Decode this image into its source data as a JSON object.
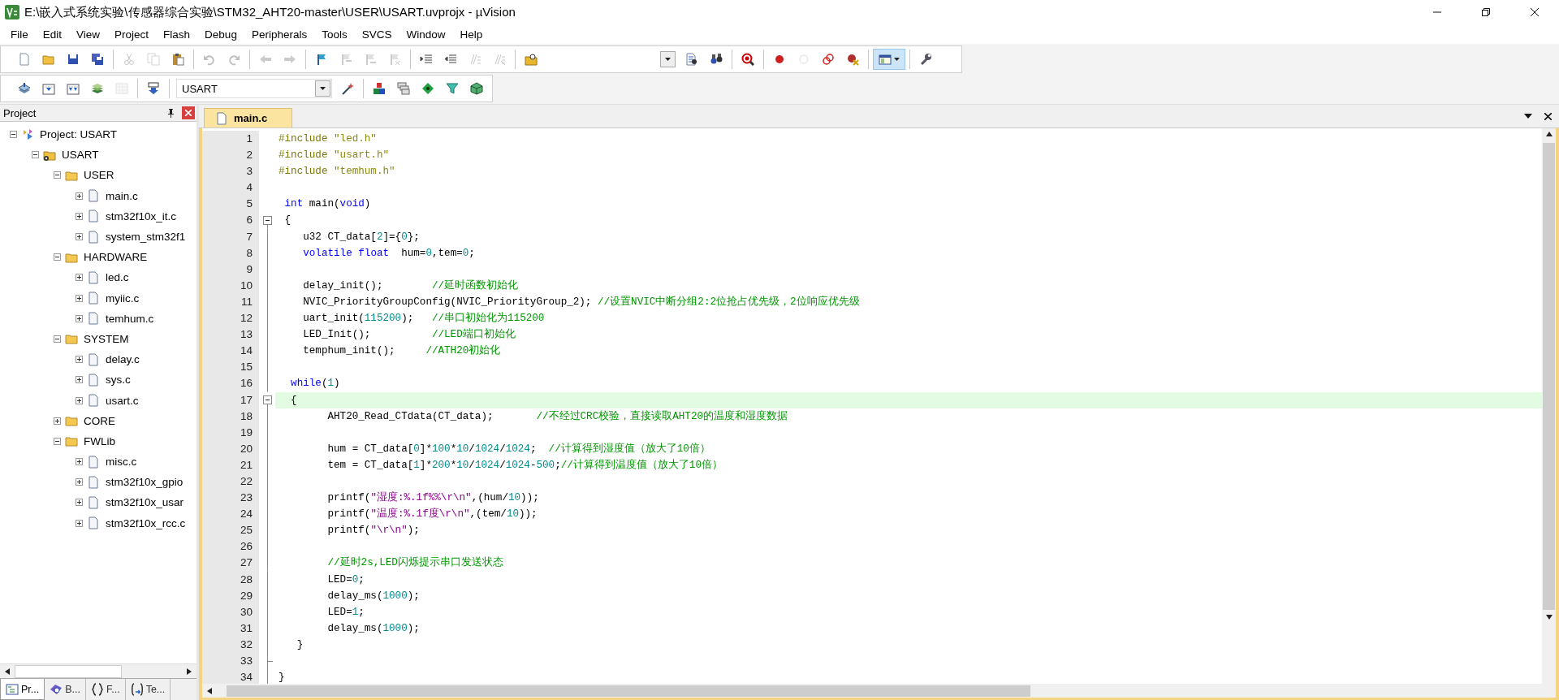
{
  "window": {
    "title": "E:\\嵌入式系统实验\\传感器综合实验\\STM32_AHT20-master\\USER\\USART.uvprojx - µVision"
  },
  "menu": [
    "File",
    "Edit",
    "View",
    "Project",
    "Flash",
    "Debug",
    "Peripherals",
    "Tools",
    "SVCS",
    "Window",
    "Help"
  ],
  "toolbar_1": [
    {
      "kind": "new",
      "disabled": false
    },
    {
      "kind": "open",
      "disabled": false
    },
    {
      "kind": "save",
      "disabled": false
    },
    {
      "kind": "save-all",
      "disabled": false
    },
    {
      "kind": "separator"
    },
    {
      "kind": "cut",
      "disabled": true
    },
    {
      "kind": "copy",
      "disabled": true
    },
    {
      "kind": "paste",
      "disabled": false
    },
    {
      "kind": "separator"
    },
    {
      "kind": "undo",
      "disabled": true
    },
    {
      "kind": "redo",
      "disabled": true
    },
    {
      "kind": "separator"
    },
    {
      "kind": "back",
      "disabled": true
    },
    {
      "kind": "forward",
      "disabled": true
    },
    {
      "kind": "separator"
    },
    {
      "kind": "bookmark",
      "disabled": false
    },
    {
      "kind": "bookmark-prev",
      "disabled": true
    },
    {
      "kind": "bookmark-next",
      "disabled": true
    },
    {
      "kind": "bookmark-clear",
      "disabled": true
    },
    {
      "kind": "separator"
    },
    {
      "kind": "indent",
      "disabled": false
    },
    {
      "kind": "unindent",
      "disabled": false
    },
    {
      "kind": "comment",
      "disabled": true
    },
    {
      "kind": "uncomment",
      "disabled": true
    },
    {
      "kind": "separator"
    },
    {
      "kind": "find-files",
      "disabled": false
    },
    {
      "kind": "combo"
    },
    {
      "kind": "find",
      "disabled": false
    },
    {
      "kind": "incremental-find",
      "disabled": false
    },
    {
      "kind": "separator"
    },
    {
      "kind": "debug",
      "disabled": false
    },
    {
      "kind": "separator"
    },
    {
      "kind": "breakpoint",
      "disabled": false
    },
    {
      "kind": "breakpoint-enable",
      "disabled": true
    },
    {
      "kind": "breakpoint-disable-all",
      "disabled": false
    },
    {
      "kind": "breakpoint-kill",
      "disabled": false
    },
    {
      "kind": "separator"
    },
    {
      "kind": "windows",
      "on": true
    },
    {
      "kind": "separator"
    },
    {
      "kind": "configure",
      "disabled": false
    }
  ],
  "toolbar_2": [
    {
      "kind": "translate",
      "disabled": false
    },
    {
      "kind": "build",
      "disabled": false
    },
    {
      "kind": "rebuild",
      "disabled": false
    },
    {
      "kind": "batch",
      "disabled": false
    },
    {
      "kind": "stop",
      "disabled": true
    },
    {
      "kind": "separator"
    },
    {
      "kind": "download",
      "disabled": false
    },
    {
      "kind": "separator"
    },
    {
      "kind": "target",
      "value": "USART"
    },
    {
      "kind": "options",
      "disabled": false
    },
    {
      "kind": "separator"
    },
    {
      "kind": "components",
      "disabled": false
    },
    {
      "kind": "items",
      "disabled": false
    },
    {
      "kind": "pack-install",
      "disabled": false
    },
    {
      "kind": "event-filter",
      "disabled": false
    },
    {
      "kind": "pack-select",
      "disabled": false
    }
  ],
  "project_panel": {
    "title": "Project",
    "tree": [
      {
        "kind": "project",
        "label": "Project: USART",
        "expanded": true,
        "children": [
          {
            "kind": "target",
            "label": "USART",
            "expanded": true,
            "children": [
              {
                "kind": "group",
                "label": "USER",
                "expanded": true,
                "children": [
                  {
                    "kind": "file",
                    "label": "main.c",
                    "expanded": false
                  },
                  {
                    "kind": "file",
                    "label": "stm32f10x_it.c",
                    "expanded": false
                  },
                  {
                    "kind": "file",
                    "label": "system_stm32f1",
                    "expanded": false
                  }
                ]
              },
              {
                "kind": "group",
                "label": "HARDWARE",
                "expanded": true,
                "children": [
                  {
                    "kind": "file",
                    "label": "led.c",
                    "expanded": false
                  },
                  {
                    "kind": "file",
                    "label": "myiic.c",
                    "expanded": false
                  },
                  {
                    "kind": "file",
                    "label": "temhum.c",
                    "expanded": false
                  }
                ]
              },
              {
                "kind": "group",
                "label": "SYSTEM",
                "expanded": true,
                "children": [
                  {
                    "kind": "file",
                    "label": "delay.c",
                    "expanded": false
                  },
                  {
                    "kind": "file",
                    "label": "sys.c",
                    "expanded": false
                  },
                  {
                    "kind": "file",
                    "label": "usart.c",
                    "expanded": false
                  }
                ]
              },
              {
                "kind": "group",
                "label": "CORE",
                "expanded": false
              },
              {
                "kind": "group",
                "label": "FWLib",
                "expanded": true,
                "children": [
                  {
                    "kind": "file",
                    "label": "misc.c",
                    "expanded": false
                  },
                  {
                    "kind": "file",
                    "label": "stm32f10x_gpio",
                    "expanded": false
                  },
                  {
                    "kind": "file",
                    "label": "stm32f10x_usar",
                    "expanded": false
                  },
                  {
                    "kind": "file",
                    "label": "stm32f10x_rcc.c",
                    "expanded": false
                  }
                ]
              }
            ]
          }
        ]
      }
    ],
    "tabs": [
      {
        "kind": "project",
        "label": "Pr...",
        "selected": true
      },
      {
        "kind": "books",
        "label": "B...",
        "selected": false
      },
      {
        "kind": "functions",
        "label": "F...",
        "selected": false
      },
      {
        "kind": "templates",
        "label": "Te...",
        "selected": false
      }
    ]
  },
  "editor": {
    "tabs": [
      {
        "label": "main.c",
        "selected": true
      }
    ],
    "lines": [
      {
        "number": "1",
        "current": false,
        "tokens": [
          {
            "kind": "preprocessor",
            "text": "#include"
          },
          {
            "kind": "include",
            "text": " \"led.h\""
          }
        ]
      },
      {
        "number": "2",
        "current": false,
        "tokens": [
          {
            "kind": "preprocessor",
            "text": "#include"
          },
          {
            "kind": "include",
            "text": " \"usart.h\""
          }
        ]
      },
      {
        "number": "3",
        "current": false,
        "tokens": [
          {
            "kind": "preprocessor",
            "text": "#include"
          },
          {
            "kind": "include",
            "text": " \"temhum.h\""
          }
        ]
      },
      {
        "number": "4",
        "current": false
      },
      {
        "number": "5",
        "current": false,
        "tokens": [
          {
            "kind": "keyword",
            "text": " int"
          },
          {
            "kind": "plain",
            "text": " main("
          },
          {
            "kind": "keyword",
            "text": "void"
          },
          {
            "kind": "plain",
            "text": ")"
          }
        ]
      },
      {
        "number": "6",
        "current": false,
        "collapsible": true,
        "tokens": [
          {
            "kind": "plain",
            "text": " {"
          }
        ]
      },
      {
        "number": "7",
        "current": false,
        "tokens": [
          {
            "kind": "plain",
            "text": "    u32 CT_data["
          },
          {
            "kind": "number",
            "text": "2"
          },
          {
            "kind": "plain",
            "text": "]={"
          },
          {
            "kind": "number",
            "text": "0"
          },
          {
            "kind": "plain",
            "text": "};"
          }
        ]
      },
      {
        "number": "8",
        "current": false,
        "tokens": [
          {
            "kind": "keyword",
            "text": "    volatile"
          },
          {
            "kind": "keyword",
            "text": " float"
          },
          {
            "kind": "plain",
            "text": "  hum="
          },
          {
            "kind": "number",
            "text": "0"
          },
          {
            "kind": "plain",
            "text": ",tem="
          },
          {
            "kind": "number",
            "text": "0"
          },
          {
            "kind": "plain",
            "text": ";"
          }
        ]
      },
      {
        "number": "9",
        "current": false
      },
      {
        "number": "10",
        "current": false,
        "tokens": [
          {
            "kind": "plain",
            "text": "    delay_init();        "
          },
          {
            "kind": "comment",
            "text": "//延时函数初始化"
          }
        ]
      },
      {
        "number": "11",
        "current": false,
        "tokens": [
          {
            "kind": "plain",
            "text": "    NVIC_PriorityGroupConfig(NVIC_PriorityGroup_2); "
          },
          {
            "kind": "comment",
            "text": "//设置NVIC中断分组2:2位抢占优先级，2位响应优先级"
          }
        ]
      },
      {
        "number": "12",
        "current": false,
        "tokens": [
          {
            "kind": "plain",
            "text": "    uart_init("
          },
          {
            "kind": "number",
            "text": "115200"
          },
          {
            "kind": "plain",
            "text": ");   "
          },
          {
            "kind": "comment",
            "text": "//串口初始化为115200"
          }
        ]
      },
      {
        "number": "13",
        "current": false,
        "tokens": [
          {
            "kind": "plain",
            "text": "    LED_Init();          "
          },
          {
            "kind": "comment",
            "text": "//LED端口初始化"
          }
        ]
      },
      {
        "number": "14",
        "current": false,
        "tokens": [
          {
            "kind": "plain",
            "text": "    temphum_init();     "
          },
          {
            "kind": "comment",
            "text": "//ATH20初始化"
          }
        ]
      },
      {
        "number": "15",
        "current": false
      },
      {
        "number": "16",
        "current": false,
        "tokens": [
          {
            "kind": "keyword",
            "text": "  while"
          },
          {
            "kind": "plain",
            "text": "("
          },
          {
            "kind": "number",
            "text": "1"
          },
          {
            "kind": "plain",
            "text": ")"
          }
        ]
      },
      {
        "number": "17",
        "current": true,
        "collapsible": true,
        "tokens": [
          {
            "kind": "plain",
            "text": "  {"
          }
        ]
      },
      {
        "number": "18",
        "current": false,
        "tokens": [
          {
            "kind": "plain",
            "text": "        AHT20_Read_CTdata(CT_data);       "
          },
          {
            "kind": "comment",
            "text": "//不经过CRC校验，直接读取AHT20的温度和湿度数据"
          }
        ]
      },
      {
        "number": "19",
        "current": false
      },
      {
        "number": "20",
        "current": false,
        "tokens": [
          {
            "kind": "plain",
            "text": "        hum = CT_data["
          },
          {
            "kind": "number",
            "text": "0"
          },
          {
            "kind": "plain",
            "text": "]*"
          },
          {
            "kind": "number",
            "text": "100"
          },
          {
            "kind": "plain",
            "text": "*"
          },
          {
            "kind": "number",
            "text": "10"
          },
          {
            "kind": "plain",
            "text": "/"
          },
          {
            "kind": "number",
            "text": "1024"
          },
          {
            "kind": "plain",
            "text": "/"
          },
          {
            "kind": "number",
            "text": "1024"
          },
          {
            "kind": "plain",
            "text": ";  "
          },
          {
            "kind": "comment",
            "text": "//计算得到湿度值（放大了10倍）"
          }
        ]
      },
      {
        "number": "21",
        "current": false,
        "tokens": [
          {
            "kind": "plain",
            "text": "        tem = CT_data["
          },
          {
            "kind": "number",
            "text": "1"
          },
          {
            "kind": "plain",
            "text": "]*"
          },
          {
            "kind": "number",
            "text": "200"
          },
          {
            "kind": "plain",
            "text": "*"
          },
          {
            "kind": "number",
            "text": "10"
          },
          {
            "kind": "plain",
            "text": "/"
          },
          {
            "kind": "number",
            "text": "1024"
          },
          {
            "kind": "plain",
            "text": "/"
          },
          {
            "kind": "number",
            "text": "1024"
          },
          {
            "kind": "plain",
            "text": "-"
          },
          {
            "kind": "number",
            "text": "500"
          },
          {
            "kind": "plain",
            "text": ";"
          },
          {
            "kind": "comment",
            "text": "//计算得到温度值（放大了10倍）"
          }
        ]
      },
      {
        "number": "22",
        "current": false
      },
      {
        "number": "23",
        "current": false,
        "tokens": [
          {
            "kind": "plain",
            "text": "        printf("
          },
          {
            "kind": "string",
            "text": "\"湿度:%.1f%%\\r\\n\""
          },
          {
            "kind": "plain",
            "text": ",(hum/"
          },
          {
            "kind": "number",
            "text": "10"
          },
          {
            "kind": "plain",
            "text": "));"
          }
        ]
      },
      {
        "number": "24",
        "current": false,
        "tokens": [
          {
            "kind": "plain",
            "text": "        printf("
          },
          {
            "kind": "string",
            "text": "\"温度:%.1f度\\r\\n\""
          },
          {
            "kind": "plain",
            "text": ",(tem/"
          },
          {
            "kind": "number",
            "text": "10"
          },
          {
            "kind": "plain",
            "text": "));"
          }
        ]
      },
      {
        "number": "25",
        "current": false,
        "tokens": [
          {
            "kind": "plain",
            "text": "        printf("
          },
          {
            "kind": "string",
            "text": "\"\\r\\n\""
          },
          {
            "kind": "plain",
            "text": ");"
          }
        ]
      },
      {
        "number": "26",
        "current": false
      },
      {
        "number": "27",
        "current": false,
        "tokens": [
          {
            "kind": "comment",
            "text": "        //延时2s,LED闪烁提示串口发送状态"
          }
        ]
      },
      {
        "number": "28",
        "current": false,
        "tokens": [
          {
            "kind": "plain",
            "text": "        LED="
          },
          {
            "kind": "number",
            "text": "0"
          },
          {
            "kind": "plain",
            "text": ";"
          }
        ]
      },
      {
        "number": "29",
        "current": false,
        "tokens": [
          {
            "kind": "plain",
            "text": "        delay_ms("
          },
          {
            "kind": "number",
            "text": "1000"
          },
          {
            "kind": "plain",
            "text": ");"
          }
        ]
      },
      {
        "number": "30",
        "current": false,
        "tokens": [
          {
            "kind": "plain",
            "text": "        LED="
          },
          {
            "kind": "number",
            "text": "1"
          },
          {
            "kind": "plain",
            "text": ";"
          }
        ]
      },
      {
        "number": "31",
        "current": false,
        "tokens": [
          {
            "kind": "plain",
            "text": "        delay_ms("
          },
          {
            "kind": "number",
            "text": "1000"
          },
          {
            "kind": "plain",
            "text": ");"
          }
        ]
      },
      {
        "number": "32",
        "current": false,
        "tokens": [
          {
            "kind": "plain",
            "text": "   }"
          }
        ]
      },
      {
        "number": "33",
        "current": false,
        "block_end": true
      },
      {
        "number": "34",
        "current": false,
        "tokens": [
          {
            "kind": "plain",
            "text": "}"
          }
        ]
      }
    ]
  }
}
